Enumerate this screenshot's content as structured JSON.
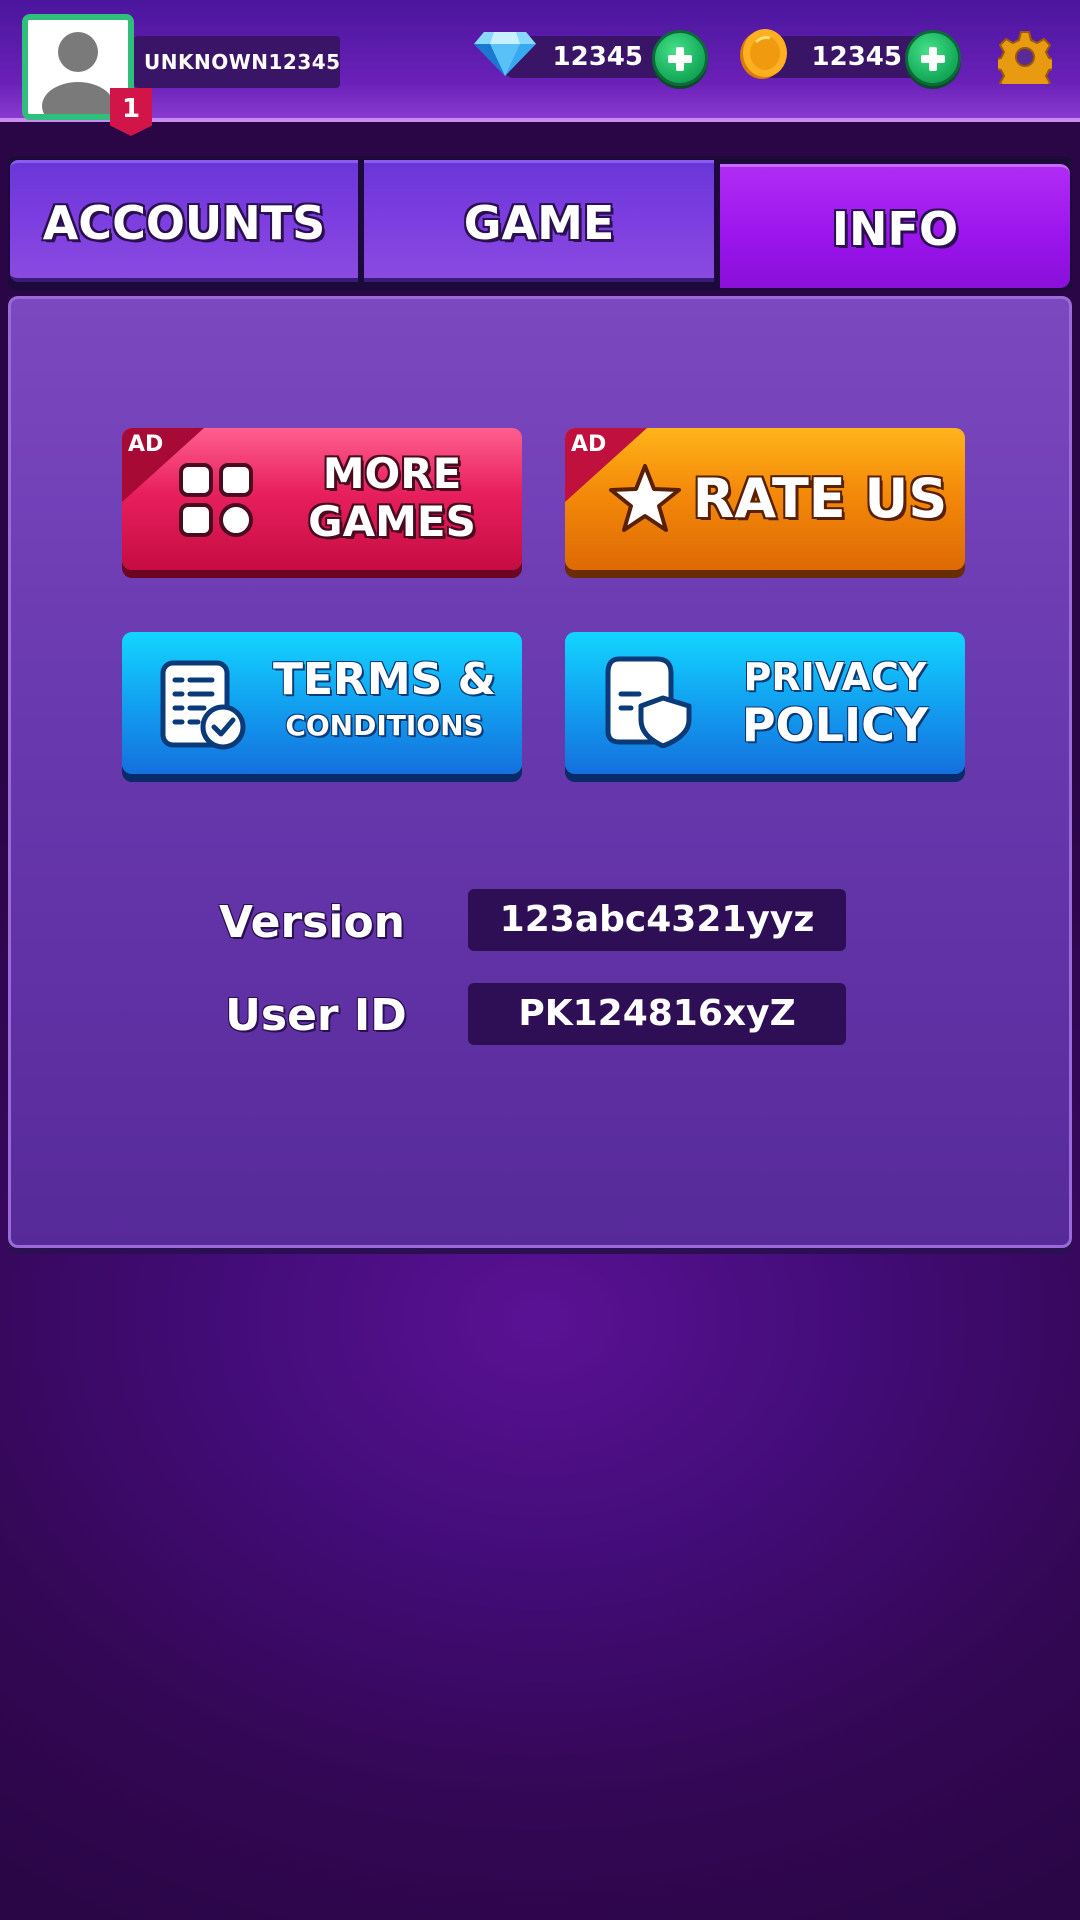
{
  "player": {
    "username": "UNKNOWN12345",
    "level": "1"
  },
  "currency": {
    "gems": "12345",
    "coins": "12345"
  },
  "tabs": [
    {
      "label": "ACCOUNTS",
      "active": false
    },
    {
      "label": "GAME",
      "active": false
    },
    {
      "label": "INFO",
      "active": true
    }
  ],
  "buttons": {
    "more_games": {
      "ad": "AD",
      "line1": "MORE",
      "line2": "GAMES"
    },
    "rate_us": {
      "ad": "AD",
      "label": "RATE US"
    },
    "terms": {
      "line1": "TERMS &",
      "line2": "CONDITIONS"
    },
    "privacy": {
      "line1": "PRIVACY",
      "line2": "POLICY"
    }
  },
  "info": {
    "version_label": "Version",
    "version_value": "123abc4321yyz",
    "user_id_label": "User ID",
    "user_id_value": "PK124816xyZ"
  },
  "colors": {
    "background": "#430c78",
    "tab_active": "#9a14ec",
    "more_games": "#e8205e",
    "rate_us": "#f48a0a",
    "info_buttons": "#12a6f2",
    "plus_green": "#18b05c"
  },
  "icons": [
    "avatar-icon",
    "gem-icon",
    "coin-icon",
    "plus-icon",
    "gear-icon",
    "grid-apps-icon",
    "star-icon",
    "document-check-icon",
    "shield-document-icon"
  ]
}
